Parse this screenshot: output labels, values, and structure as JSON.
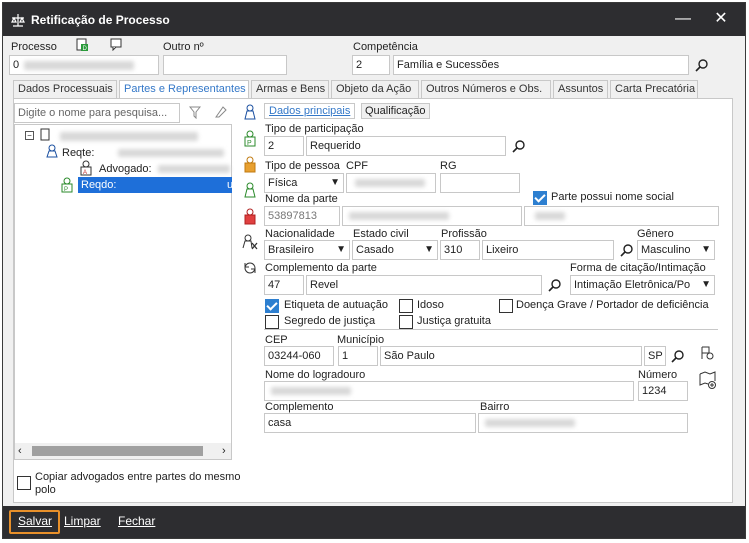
{
  "window": {
    "title": "Retificação de Processo",
    "close": "✕",
    "minimize": "—"
  },
  "header": {
    "processo_label": "Processo",
    "processo_value": "0",
    "outro_label": "Outro nº",
    "competencia_label": "Competência",
    "competencia_code": "2",
    "competencia_value": "Família e Sucessões"
  },
  "tabs": [
    "Dados Processuais",
    "Partes e Representantes",
    "Armas e Bens",
    "Objeto da Ação",
    "Outros Números e Obs.",
    "Assuntos",
    "Carta Precatória"
  ],
  "left": {
    "search_placeholder": "Digite o nome para pesquisa...",
    "tree": {
      "reqte": "Reqte: ",
      "advogado": "Advogado: ",
      "reqdo": "Reqdo: "
    },
    "copy_label": "Copiar advogados entre partes do mesmo polo"
  },
  "subtabs": [
    "Dados principais",
    "Qualificação"
  ],
  "form": {
    "tipo_participacao_label": "Tipo de participação",
    "tipo_participacao_code": "2",
    "tipo_participacao_value": "Requerido",
    "tipo_pessoa_label": "Tipo de pessoa",
    "tipo_pessoa_value": "Física",
    "cpf_label": "CPF",
    "rg_label": "RG",
    "nome_social_label": "Parte possui nome social",
    "nome_parte_label": "Nome da parte",
    "nome_parte_code": "53897813",
    "nacionalidade_label": "Nacionalidade",
    "nacionalidade_value": "Brasileiro",
    "estado_civil_label": "Estado civil",
    "estado_civil_value": "Casado",
    "profissao_label": "Profissão",
    "profissao_code": "310",
    "profissao_value": "Lixeiro",
    "genero_label": "Gênero",
    "genero_value": "Masculino",
    "complemento_parte_label": "Complemento da parte",
    "complemento_parte_code": "47",
    "complemento_parte_value": "Revel",
    "forma_citacao_label": "Forma de citação/Intimação",
    "forma_citacao_value": "Intimação Eletrônica/Po",
    "etiqueta_label": "Etiqueta de autuação",
    "idoso_label": "Idoso",
    "doenca_label": "Doença Grave / Portador de deficiência",
    "segredo_label": "Segredo de justiça",
    "justica_label": "Justiça gratuita",
    "cep_label": "CEP",
    "cep_value": "03244-060",
    "municipio_label": "Município",
    "municipio_code": "1",
    "municipio_value": "São Paulo",
    "uf_value": "SP",
    "logradouro_label": "Nome do logradouro",
    "numero_label": "Número",
    "numero_value": "1234",
    "complemento_label": "Complemento",
    "complemento_value": "casa",
    "bairro_label": "Bairro"
  },
  "footer": {
    "salvar": "Salvar",
    "limpar": "Limpar",
    "fechar": "Fechar"
  },
  "colors": {
    "titlebar": "#2d2d30",
    "accent": "#2d7fd0",
    "highlight": "#e8902a",
    "selection": "#1e6fd9"
  }
}
